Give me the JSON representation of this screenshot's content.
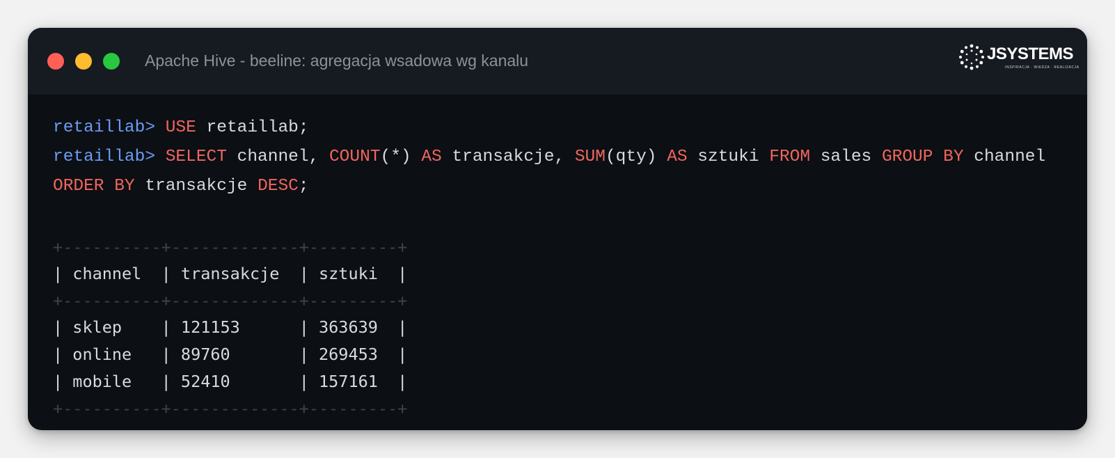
{
  "window": {
    "title": "Apache Hive - beeline: agregacja wsadowa wg kanalu",
    "controls": [
      "close",
      "minimize",
      "maximize"
    ]
  },
  "logo": {
    "name": "JSYSTEMS",
    "tagline": "INSPIRACJA · WIEDZA · REALIZACJA"
  },
  "terminal": {
    "lines": [
      {
        "prompt": "retaillab>",
        "tokens": [
          {
            "t": "USE",
            "kw": true
          },
          {
            "t": " retaillab;",
            "kw": false
          }
        ]
      },
      {
        "prompt": "retaillab>",
        "tokens": [
          {
            "t": "SELECT",
            "kw": true
          },
          {
            "t": " channel, ",
            "kw": false
          },
          {
            "t": "COUNT",
            "kw": true
          },
          {
            "t": "(*) ",
            "kw": false
          },
          {
            "t": "AS",
            "kw": true
          },
          {
            "t": " transakcje, ",
            "kw": false
          },
          {
            "t": "SUM",
            "kw": true
          },
          {
            "t": "(qty) ",
            "kw": false
          },
          {
            "t": "AS",
            "kw": true
          },
          {
            "t": " sztuki ",
            "kw": false
          },
          {
            "t": "FROM",
            "kw": true
          },
          {
            "t": " sales ",
            "kw": false
          },
          {
            "t": "GROUP BY",
            "kw": true
          },
          {
            "t": " channel",
            "kw": false
          }
        ]
      },
      {
        "prompt": "",
        "tokens": [
          {
            "t": "ORDER BY",
            "kw": true
          },
          {
            "t": " transakcje ",
            "kw": false
          },
          {
            "t": "DESC",
            "kw": true
          },
          {
            "t": ";",
            "kw": false
          }
        ]
      }
    ]
  },
  "result": {
    "separator": "+----------+-------------+---------+",
    "columns": [
      "channel",
      "transakcje",
      "sztuki"
    ],
    "rows": [
      [
        "sklep",
        "121153",
        "363639"
      ],
      [
        "online",
        "89760",
        "269453"
      ],
      [
        "mobile",
        "52410",
        "157161"
      ]
    ]
  },
  "colors": {
    "background": "#0c0f14",
    "titlebar": "#161a21",
    "prompt": "#6c9cf2",
    "keyword": "#f0665d",
    "text": "#d7dbe0",
    "border": "#3d434c",
    "close": "#ff5f57",
    "minimize": "#febc2e",
    "maximize": "#28c840"
  }
}
